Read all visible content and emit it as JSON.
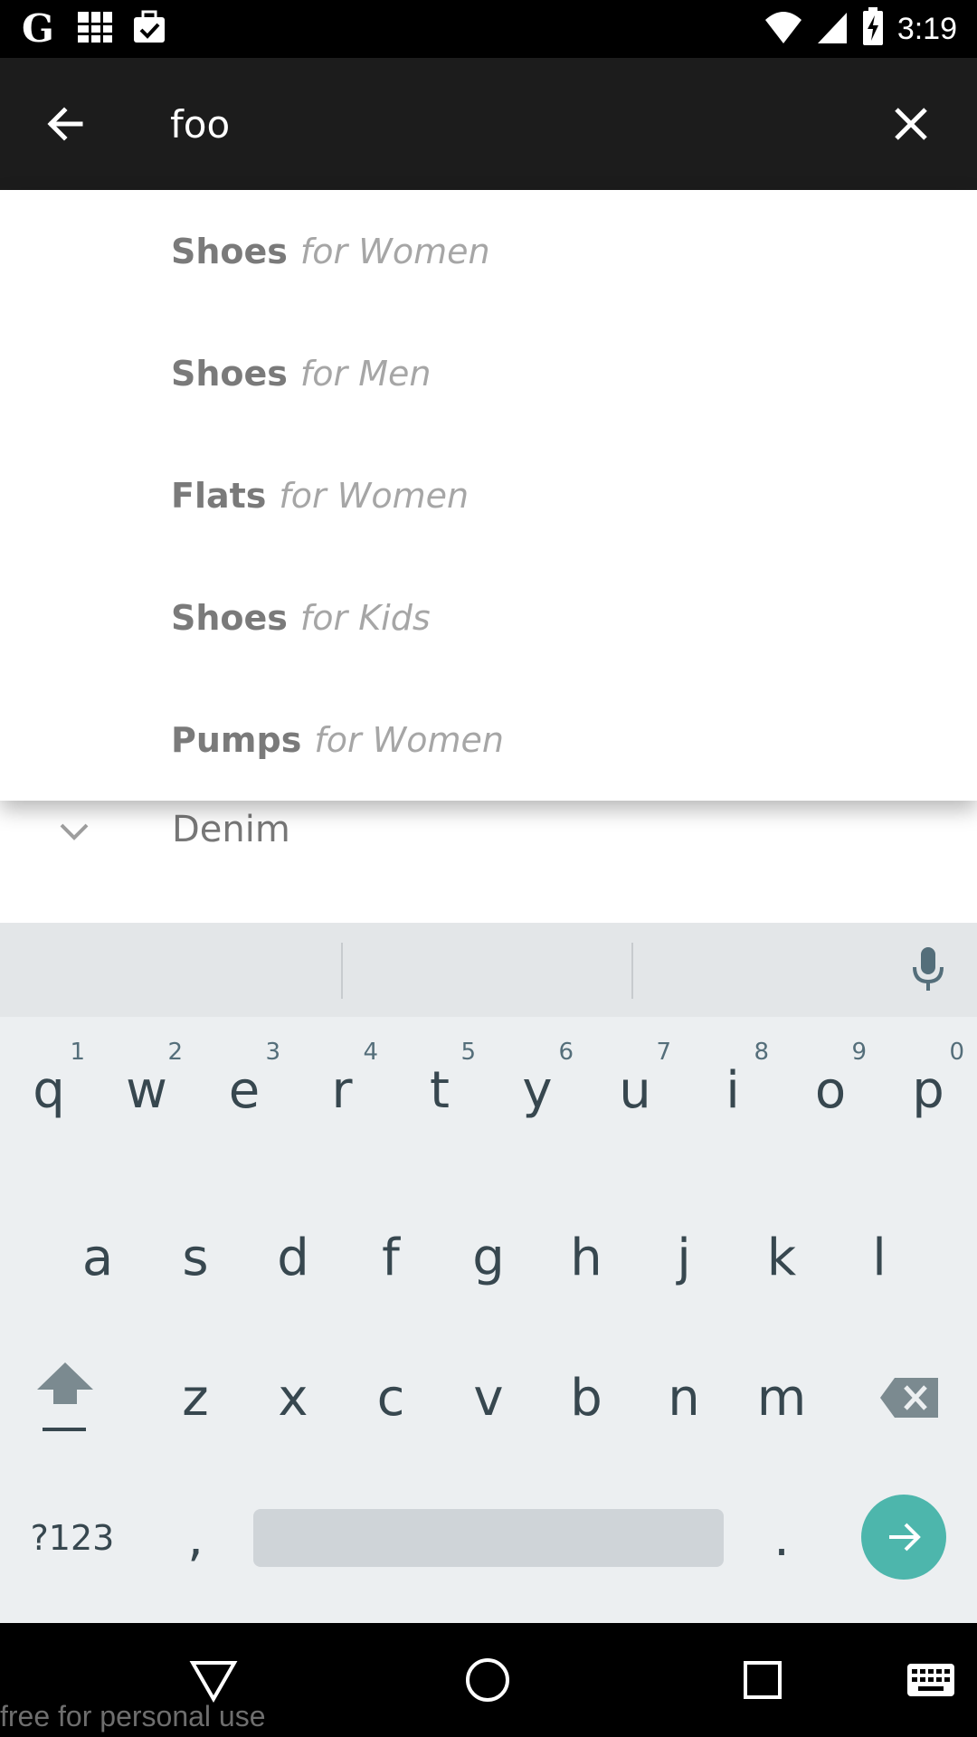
{
  "status_bar": {
    "time": "3:19",
    "left_icons": [
      "google-icon",
      "grid-app-icon",
      "briefcase-check-icon"
    ],
    "right_icons": [
      "wifi-icon",
      "cell-signal-icon",
      "battery-charging-icon"
    ]
  },
  "search": {
    "query": "foo",
    "back_icon": "arrow-left-icon",
    "clear_icon": "close-icon"
  },
  "suggestions": [
    {
      "term": "Shoes",
      "scope": "for Women"
    },
    {
      "term": "Shoes",
      "scope": "for Men"
    },
    {
      "term": "Flats",
      "scope": "for Women"
    },
    {
      "term": "Shoes",
      "scope": "for Kids"
    },
    {
      "term": "Pumps",
      "scope": "for Women"
    }
  ],
  "background": {
    "denim_label": "Denim",
    "denim_icon": "chevron-down-icon"
  },
  "keyboard": {
    "row1": [
      {
        "key": "q",
        "hint": "1"
      },
      {
        "key": "w",
        "hint": "2"
      },
      {
        "key": "e",
        "hint": "3"
      },
      {
        "key": "r",
        "hint": "4"
      },
      {
        "key": "t",
        "hint": "5"
      },
      {
        "key": "y",
        "hint": "6"
      },
      {
        "key": "u",
        "hint": "7"
      },
      {
        "key": "i",
        "hint": "8"
      },
      {
        "key": "o",
        "hint": "9"
      },
      {
        "key": "p",
        "hint": "0"
      }
    ],
    "row2": [
      "a",
      "s",
      "d",
      "f",
      "g",
      "h",
      "j",
      "k",
      "l"
    ],
    "row3": [
      "z",
      "x",
      "c",
      "v",
      "b",
      "n",
      "m"
    ],
    "symbols_label": "?123",
    "comma": ",",
    "period": ".",
    "accent_color": "#4db6ac"
  },
  "nav_bar": {
    "buttons": [
      "back-triangle-icon",
      "home-circle-icon",
      "recents-square-icon",
      "keyboard-icon"
    ]
  },
  "watermark": "free for personal use"
}
